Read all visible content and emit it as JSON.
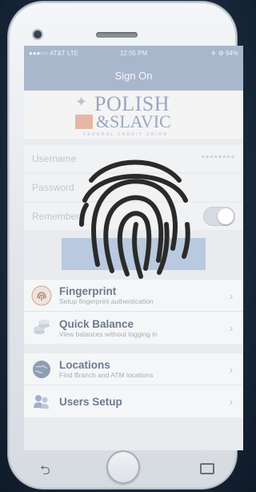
{
  "status_bar": {
    "carrier": "●●●○○ AT&T LTE",
    "time": "12:55 PM",
    "battery": "✈ ⚙ 94%"
  },
  "nav": {
    "title": "Sign On"
  },
  "logo": {
    "line1": "POLISH",
    "line2": "&SLAVIC",
    "tagline": "FEDERAL CREDIT UNION"
  },
  "form": {
    "username_placeholder": "Username",
    "username_value": "********",
    "password_placeholder": "Password",
    "remember_label": "Remember",
    "remember_on": true
  },
  "menu_group_1": [
    {
      "title": "Fingerprint",
      "subtitle": "Setup fingerprint authentication",
      "icon": "fingerprint-icon"
    },
    {
      "title": "Quick Balance",
      "subtitle": "View balances without logging in",
      "icon": "coins-icon"
    }
  ],
  "menu_group_2": [
    {
      "title": "Locations",
      "subtitle": "Find Branch and ATM locations",
      "icon": "globe-icon"
    },
    {
      "title": "Users Setup",
      "subtitle": "",
      "icon": "users-icon"
    }
  ],
  "colors": {
    "header": "#a9b7cc",
    "menu_title": "#6c7a90",
    "fingerprint_overlay": "#2a2a2a"
  }
}
